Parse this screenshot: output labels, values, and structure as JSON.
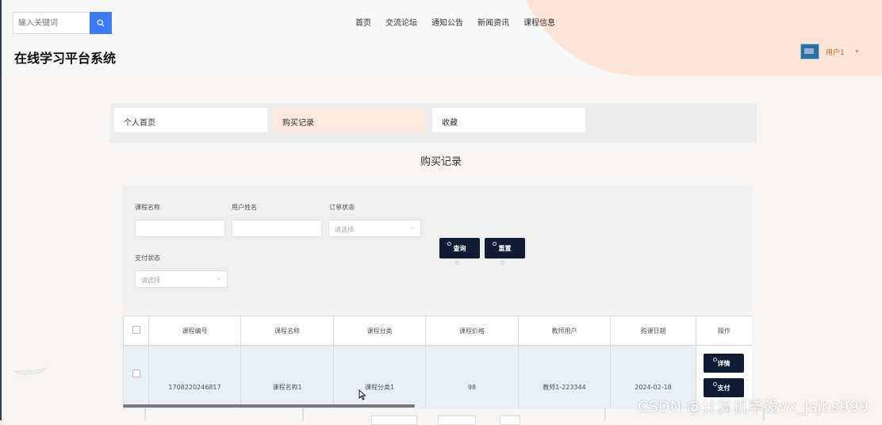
{
  "header": {
    "search_placeholder": "输入关键词",
    "site_title": "在线学习平台系统",
    "username": "用户1",
    "nav": [
      "首页",
      "交流论坛",
      "通知公告",
      "新闻资讯",
      "课程信息"
    ]
  },
  "tabs": [
    "个人首页",
    "购买记录",
    "收藏"
  ],
  "active_tab": "购买记录",
  "section_title": "购买记录",
  "filters": {
    "course_name_label": "课程名称",
    "user_name_label": "用户姓名",
    "order_status_label": "订单状态",
    "order_status_placeholder": "请选择",
    "pay_status_label": "支付状态",
    "pay_status_placeholder": "请选择",
    "search_button": "查询",
    "reset_button": "重置"
  },
  "table": {
    "columns": [
      "课程编号",
      "课程名称",
      "课程分类",
      "课程价格",
      "教师用户",
      "购课日期",
      "操作"
    ],
    "rows": [
      {
        "code": "1708220246817",
        "name": "课程名称1",
        "category": "课程分类1",
        "price": "98",
        "teacher": "教师1-223344",
        "date": "2024-02-18",
        "detail_button": "详情",
        "pay_button": "支付"
      }
    ]
  },
  "watermark": "CSDN @计算机毕设vx_jsjbs999",
  "colors": {
    "accent_blue": "#3d7cf5",
    "dark_button": "#0f1c34",
    "user_orange": "#e0682b",
    "active_tab_bg": "#fbe9e0"
  }
}
